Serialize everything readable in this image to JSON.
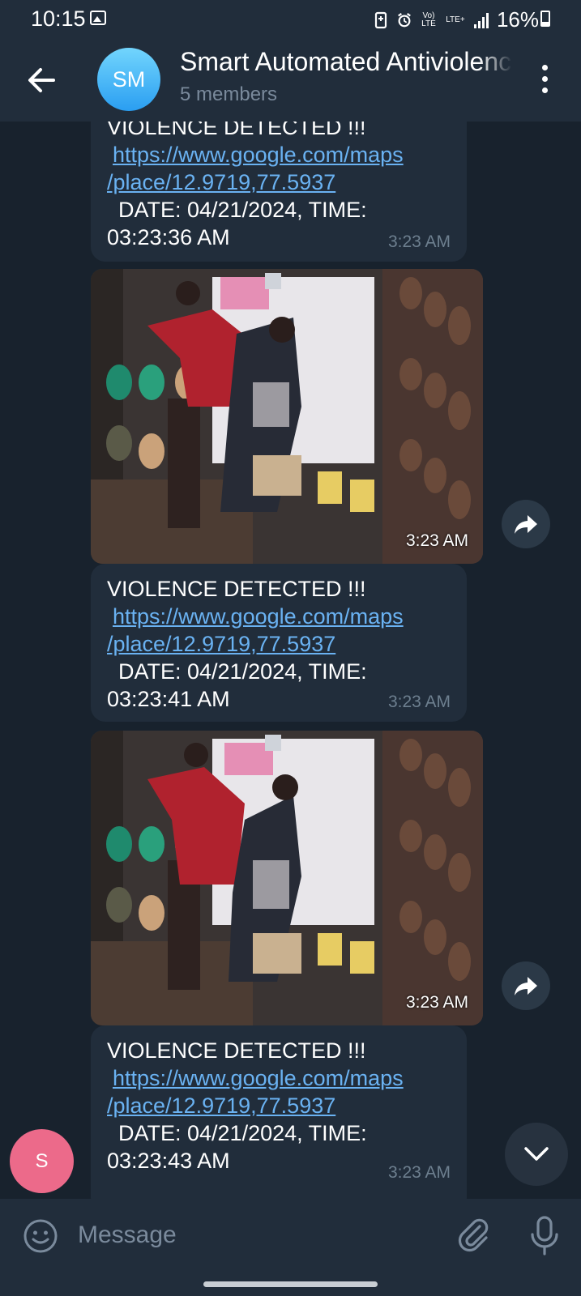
{
  "status_bar": {
    "time": "10:15",
    "volte": "Vo) LTE",
    "lte": "LTE+",
    "battery": "16%"
  },
  "header": {
    "avatar_initials": "SM",
    "title": "Smart Automated Antiviolence",
    "subtitle": "5 members"
  },
  "messages": [
    {
      "type": "text",
      "heading": "VIOLENCE DETECTED !!!",
      "link_line1": "https://www.google.com/maps",
      "link_line2": "/place/12.9719,77.5937",
      "date_line": "DATE: 04/21/2024, TIME:",
      "time_line": "03:23:36 AM",
      "sent_time": "3:23 AM"
    },
    {
      "type": "photo",
      "sent_time": "3:23 AM"
    },
    {
      "type": "text",
      "heading": "VIOLENCE DETECTED !!!",
      "link_line1": "https://www.google.com/maps",
      "link_line2": "/place/12.9719,77.5937",
      "date_line": "DATE: 04/21/2024, TIME:",
      "time_line": "03:23:41 AM",
      "sent_time": "3:23 AM"
    },
    {
      "type": "photo",
      "sent_time": "3:23 AM"
    },
    {
      "type": "text",
      "heading": "VIOLENCE DETECTED !!!",
      "link_line1": "https://www.google.com/maps",
      "link_line2": "/place/12.9719,77.5937",
      "date_line": "DATE: 04/21/2024, TIME:",
      "time_line": "03:23:43 AM",
      "sent_time": "3:23 AM"
    }
  ],
  "sender_avatar": "S",
  "input": {
    "placeholder": "Message"
  },
  "colors": {
    "background": "#18222d",
    "bubble": "#212d3b",
    "link": "#6ab2f2",
    "avatar_group": "#3fa9f5",
    "avatar_sender": "#ec6a8a"
  },
  "icons": [
    "back-arrow-icon",
    "more-vertical-icon",
    "share-arrow-icon",
    "chevron-down-icon",
    "emoji-icon",
    "paperclip-icon",
    "microphone-icon"
  ]
}
